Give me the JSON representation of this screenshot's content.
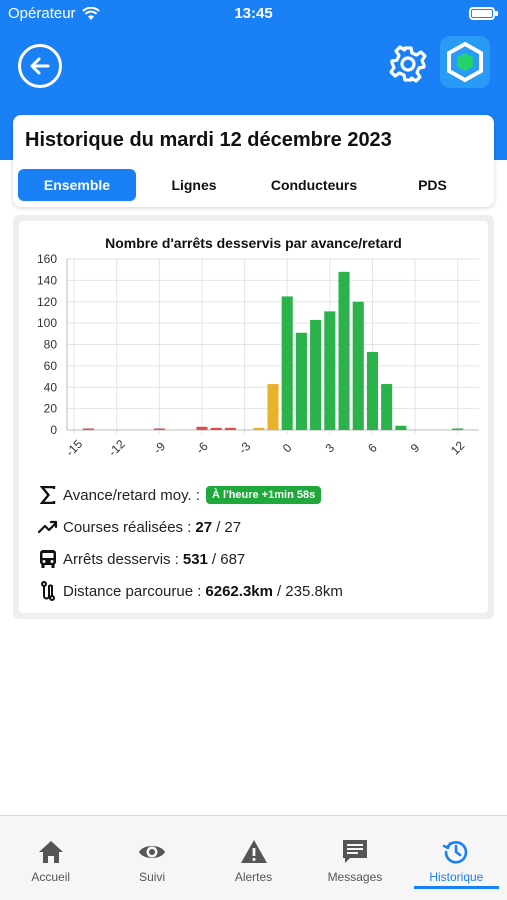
{
  "status_bar": {
    "carrier": "Opérateur",
    "time": "13:45"
  },
  "header": {
    "back_icon": "back-arrow-icon",
    "settings_icon": "gear-icon",
    "logo_icon": "app-logo-icon"
  },
  "page": {
    "title": "Historique du mardi 12 décembre 2023",
    "tabs": [
      {
        "label": "Ensemble",
        "active": true
      },
      {
        "label": "Lignes",
        "active": false
      },
      {
        "label": "Conducteurs",
        "active": false
      },
      {
        "label": "PDS",
        "active": false
      }
    ]
  },
  "chart_data": {
    "type": "bar",
    "title": "Nombre d'arrêts desservis par avance/retard",
    "xlabel": "",
    "ylabel": "",
    "ylim": [
      0,
      160
    ],
    "yticks": [
      "0",
      "20",
      "40",
      "60",
      "80",
      "100",
      "120",
      "140",
      "160"
    ],
    "xticks": [
      "-15",
      "-12",
      "-9",
      "-6",
      "-3",
      "0",
      "3",
      "6",
      "9",
      "12"
    ],
    "x": [
      -15,
      -14,
      -13,
      -12,
      -11,
      -10,
      -9,
      -8,
      -7,
      -6,
      -5,
      -4,
      -3,
      -2,
      -1,
      0,
      1,
      2,
      3,
      4,
      5,
      6,
      7,
      8,
      9,
      10,
      11,
      12,
      13
    ],
    "values": [
      0,
      1,
      0,
      0,
      0,
      0,
      1,
      0,
      0,
      3,
      2,
      2,
      0,
      2,
      43,
      125,
      91,
      103,
      111,
      148,
      120,
      73,
      43,
      4,
      0,
      0,
      0,
      1,
      0
    ],
    "colors": {
      "late": "#e24b4b",
      "early": "#e8b32a",
      "on_time": "#2bb24a"
    },
    "grid": true,
    "legend": "none"
  },
  "stats": {
    "avg": {
      "label": "Avance/retard moy. :",
      "badge": "À l'heure +1min 58s",
      "icon": "sigma-icon"
    },
    "courses": {
      "label": "Courses réalisées :",
      "value": "27",
      "total": "/ 27",
      "icon": "trend-up-icon"
    },
    "stops": {
      "label": "Arrêts desservis :",
      "value": "531",
      "total": "/ 687",
      "icon": "bus-icon"
    },
    "distance": {
      "label": "Distance parcourue :",
      "value": "6262.3km",
      "total": "/ 235.8km",
      "icon": "route-icon"
    }
  },
  "tabbar": {
    "items": [
      {
        "label": "Accueil",
        "icon": "home-icon",
        "active": false
      },
      {
        "label": "Suivi",
        "icon": "eye-icon",
        "active": false
      },
      {
        "label": "Alertes",
        "icon": "alert-icon",
        "active": false
      },
      {
        "label": "Messages",
        "icon": "messages-icon",
        "active": false
      },
      {
        "label": "Historique",
        "icon": "history-icon",
        "active": true
      }
    ]
  },
  "colors": {
    "primary": "#1a80f5",
    "badge_green": "#1fa83c"
  }
}
